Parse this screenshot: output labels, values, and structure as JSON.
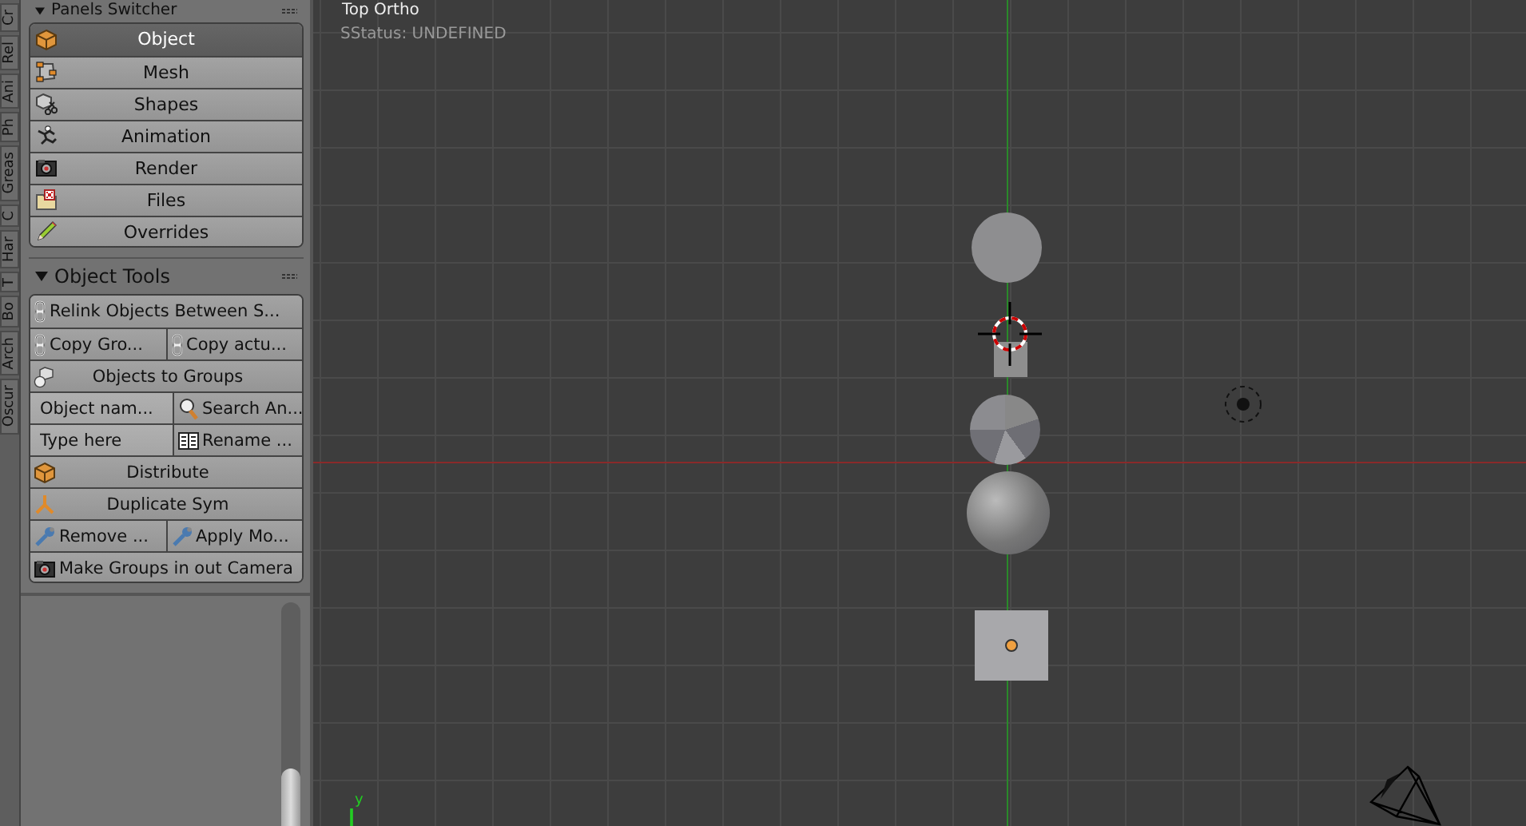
{
  "side_tabs": [
    {
      "label": "Cr"
    },
    {
      "label": "Rel"
    },
    {
      "label": "Ani"
    },
    {
      "label": "Ph"
    },
    {
      "label": "Greas"
    },
    {
      "label": "C"
    },
    {
      "label": "Har"
    },
    {
      "label": "T"
    },
    {
      "label": "Bo"
    },
    {
      "label": "Arch"
    },
    {
      "label": "Oscur"
    }
  ],
  "panels_switcher": {
    "title": "Panels Switcher",
    "items": [
      {
        "label": "Object",
        "selected": true
      },
      {
        "label": "Mesh",
        "selected": false
      },
      {
        "label": "Shapes",
        "selected": false
      },
      {
        "label": "Animation",
        "selected": false
      },
      {
        "label": "Render",
        "selected": false
      },
      {
        "label": "Files",
        "selected": false
      },
      {
        "label": "Overrides",
        "selected": false
      }
    ]
  },
  "object_tools": {
    "title": "Object Tools",
    "rows": [
      [
        {
          "kind": "button",
          "label": "Relink Objects Between S..."
        }
      ],
      [
        {
          "kind": "button",
          "label": "Copy Gro..."
        },
        {
          "kind": "button",
          "label": "Copy actu..."
        }
      ],
      [
        {
          "kind": "button",
          "label": "Objects to Groups"
        }
      ],
      [
        {
          "kind": "field",
          "value": "Object nam..."
        },
        {
          "kind": "button",
          "label": "Search An..."
        }
      ],
      [
        {
          "kind": "field",
          "placeholder": "Type here"
        },
        {
          "kind": "button",
          "label": "Rename ..."
        }
      ],
      [
        {
          "kind": "button",
          "label": "Distribute"
        }
      ],
      [
        {
          "kind": "button",
          "label": "Duplicate Sym"
        }
      ],
      [
        {
          "kind": "button",
          "label": "Remove ..."
        },
        {
          "kind": "button",
          "label": "Apply Mo..."
        }
      ],
      [
        {
          "kind": "button",
          "label": "Make Groups in out Camera"
        }
      ]
    ]
  },
  "viewport": {
    "view_name": "Top Ortho",
    "status": "SStatus: UNDEFINED",
    "axis_label": "y"
  }
}
